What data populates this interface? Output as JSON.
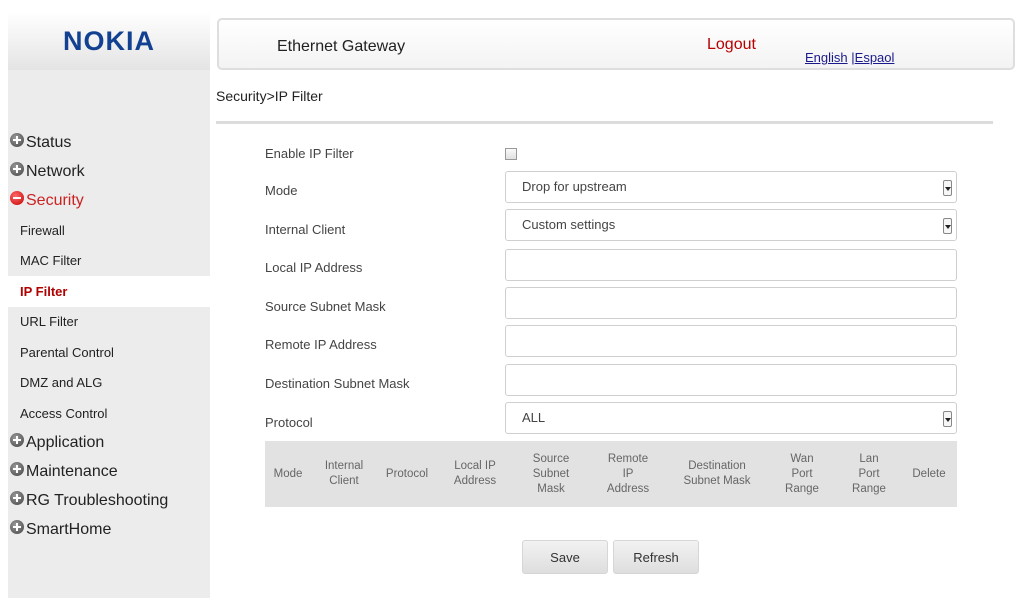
{
  "brand": {
    "logo_text": "NOKIA",
    "color": "#124191"
  },
  "header": {
    "title": "Ethernet Gateway",
    "logout": "Logout",
    "lang_english": "English",
    "lang_separator": "|",
    "lang_spanish": "Espaol"
  },
  "sidebar": {
    "status": "Status",
    "network": "Network",
    "security": "Security",
    "security_items": [
      "Firewall",
      "MAC Filter",
      "IP Filter",
      "URL Filter",
      "Parental Control",
      "DMZ and ALG",
      "Access Control"
    ],
    "application": "Application",
    "maintenance": "Maintenance",
    "rg_troubleshooting": "RG Troubleshooting",
    "smarthome": "SmartHome"
  },
  "breadcrumb": "Security>IP Filter",
  "form": {
    "enable_label": "Enable IP Filter",
    "enable_checked": false,
    "mode_label": "Mode",
    "mode_value": "Drop for upstream",
    "internal_client_label": "Internal Client",
    "internal_client_value": "Custom settings",
    "local_ip_label": "Local IP Address",
    "local_ip_value": "",
    "source_mask_label": "Source Subnet Mask",
    "source_mask_value": "",
    "remote_ip_label": "Remote IP Address",
    "remote_ip_value": "",
    "dest_mask_label": "Destination Subnet Mask",
    "dest_mask_value": "",
    "protocol_label": "Protocol",
    "protocol_value": "ALL"
  },
  "table": {
    "headers": [
      "Mode",
      "Internal Client",
      "Protocol",
      "Local IP Address",
      "Source Subnet Mask",
      "Remote IP Address",
      "Destination Subnet Mask",
      "Wan Port Range",
      "Lan Port Range",
      "Delete"
    ]
  },
  "buttons": {
    "save": "Save",
    "refresh": "Refresh"
  },
  "colors": {
    "accent_red": "#b80000",
    "active_menu_red": "#cc2222",
    "link_blue": "#1a1a8c"
  }
}
